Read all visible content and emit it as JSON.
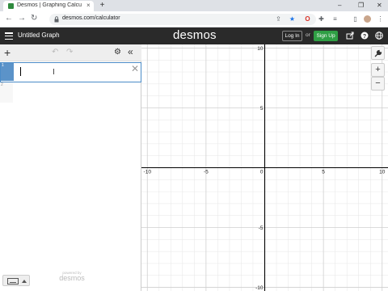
{
  "browser": {
    "tab_title": "Desmos | Graphing Calculator",
    "tab_close": "×",
    "new_tab": "+",
    "url": "desmos.com/calculator",
    "window_controls": [
      "–",
      "❐",
      "✕"
    ]
  },
  "header": {
    "title": "Untitled Graph",
    "logo": "desmos",
    "login_label": "Log In",
    "or_label": "or",
    "signup_label": "Sign Up"
  },
  "expressions": {
    "add_label": "+",
    "rows": [
      {
        "index": "1",
        "value": ""
      },
      {
        "index": "2",
        "value": ""
      }
    ],
    "delete_label": "✕",
    "powered_by": "powered by",
    "powered_logo": "desmos"
  },
  "graph": {
    "x_ticks": [
      "-10",
      "-5",
      "0",
      "5",
      "10"
    ],
    "y_ticks": [
      "10",
      "5",
      "-5",
      "-10"
    ],
    "x_range": [
      -10.5,
      10.5
    ],
    "y_range": [
      -10.3,
      10.3
    ],
    "zoom_in_label": "+",
    "zoom_out_label": "−"
  },
  "colors": {
    "header_bg": "#2a2a2a",
    "signup_green": "#2f9e44",
    "row_accent": "#5b93c9",
    "grid": "#e6e6e6",
    "axis": "#000000"
  }
}
